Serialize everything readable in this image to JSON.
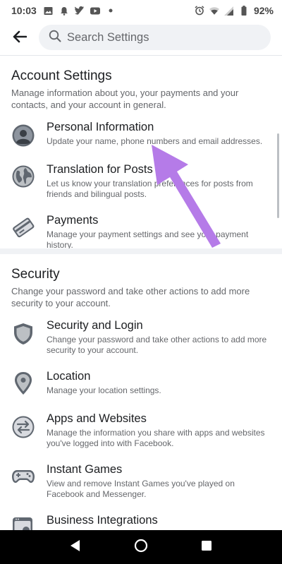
{
  "status_bar": {
    "time": "10:03",
    "battery": "92%",
    "left_icons": [
      "image-icon",
      "notification-bell-icon",
      "twitter-icon",
      "youtube-icon",
      "dot-icon"
    ],
    "right_icons": [
      "alarm-icon",
      "wifi-icon",
      "signal-icon",
      "battery-icon"
    ]
  },
  "header": {
    "back_icon": "back-arrow-icon",
    "search_placeholder": "Search Settings"
  },
  "account_settings": {
    "title": "Account Settings",
    "description": "Manage information about you, your payments and your contacts, and your account in general.",
    "items": [
      {
        "icon": "person-avatar-icon",
        "title": "Personal Information",
        "description": "Update your name, phone numbers and email addresses."
      },
      {
        "icon": "globe-icon",
        "title": "Translation for Posts",
        "description": "Let us know your translation preferences for posts from friends and bilingual posts."
      },
      {
        "icon": "payment-card-icon",
        "title": "Payments",
        "description": "Manage your payment settings and see your payment history."
      }
    ]
  },
  "security": {
    "title": "Security",
    "description": "Change your password and take other actions to add more security to your account.",
    "items": [
      {
        "icon": "shield-icon",
        "title": "Security and Login",
        "description": "Change your password and take other actions to add more security to your account."
      },
      {
        "icon": "location-pin-icon",
        "title": "Location",
        "description": "Manage your location settings."
      },
      {
        "icon": "apps-swap-icon",
        "title": "Apps and Websites",
        "description": "Manage the information you share with apps and websites you've logged into with Facebook."
      },
      {
        "icon": "gamepad-icon",
        "title": "Instant Games",
        "description": "View and remove Instant Games you've played on Facebook and Messenger."
      },
      {
        "icon": "business-integrations-icon",
        "title": "Business Integrations",
        "description": ""
      }
    ]
  },
  "nav_bar": {
    "buttons": [
      "back-triangle-icon",
      "home-circle-icon",
      "recents-square-icon"
    ]
  },
  "colors": {
    "annotation_arrow": "#b57be8",
    "icon_gray": "#606770",
    "icon_light": "#e4e6eb"
  }
}
